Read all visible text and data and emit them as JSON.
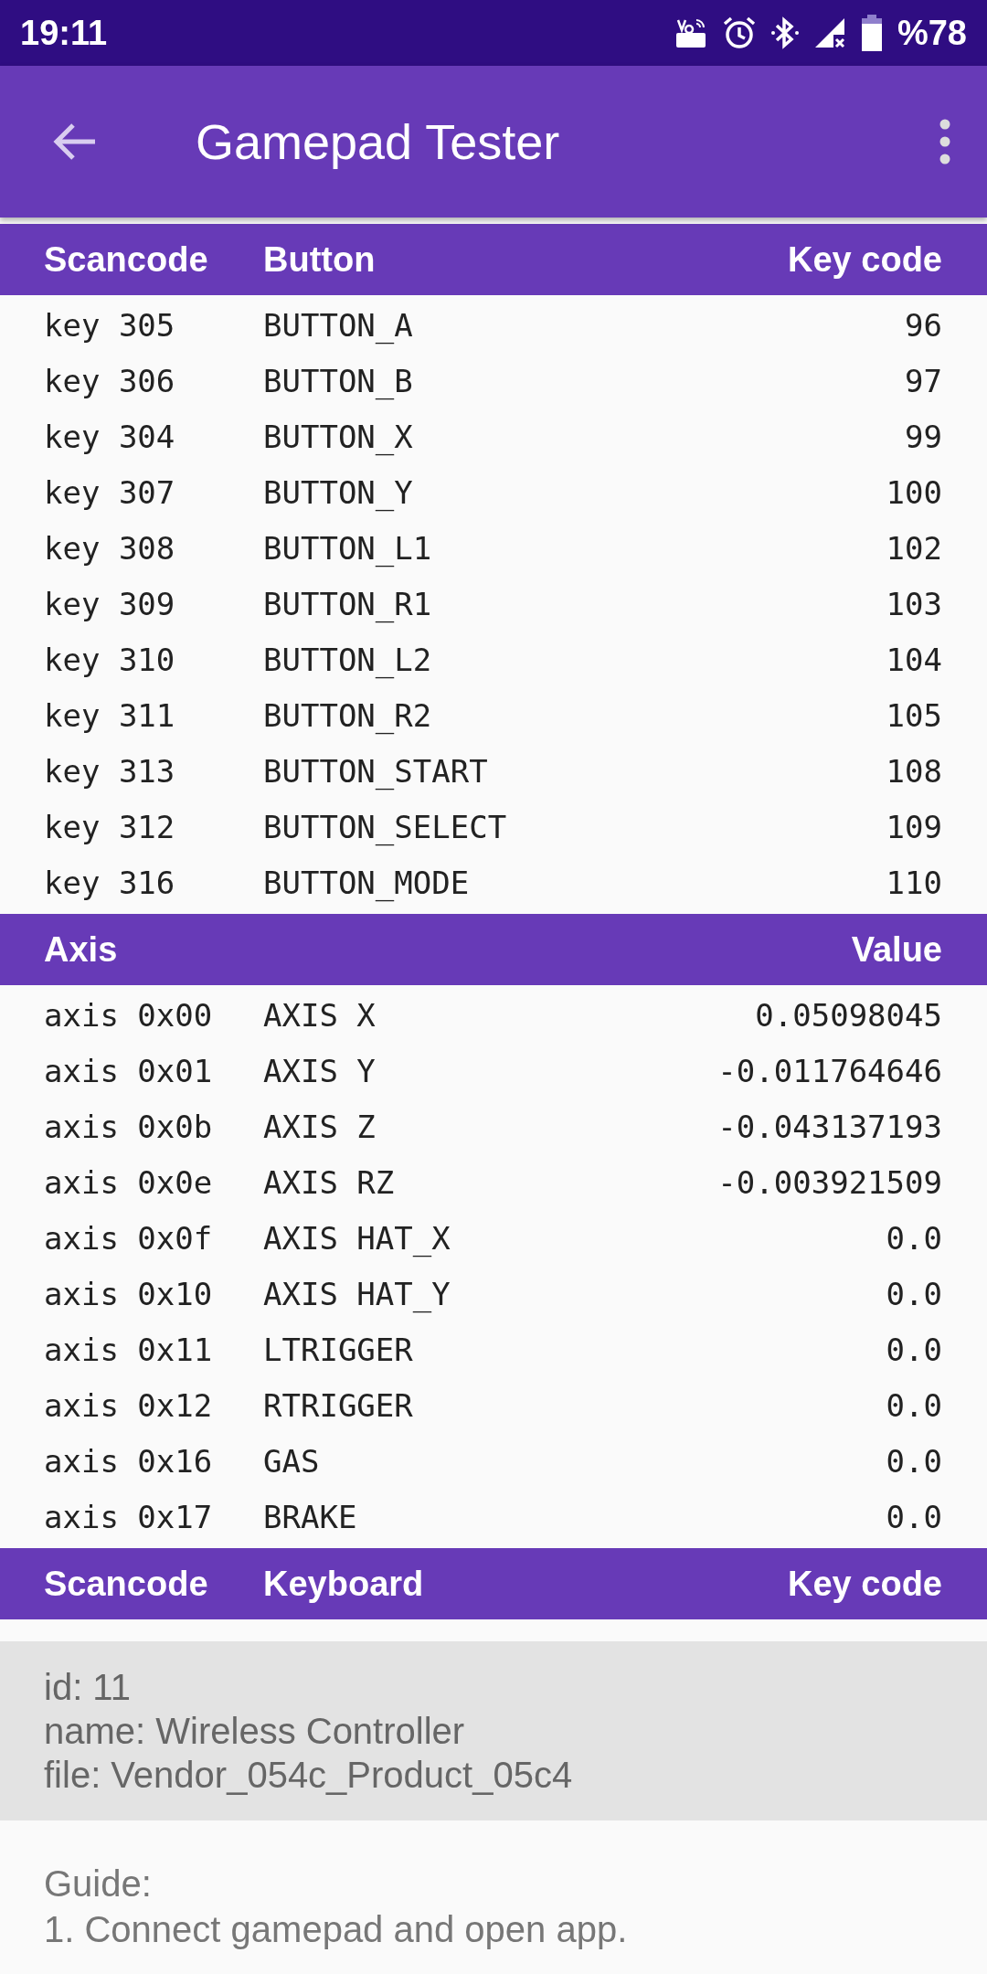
{
  "status_bar": {
    "time": "19:11",
    "battery": "%78"
  },
  "app_bar": {
    "title": "Gamepad Tester"
  },
  "buttons_table": {
    "columns": [
      "Scancode",
      "Button",
      "Key code"
    ],
    "rows": [
      [
        "key 305",
        "BUTTON_A",
        "96"
      ],
      [
        "key 306",
        "BUTTON_B",
        "97"
      ],
      [
        "key 304",
        "BUTTON_X",
        "99"
      ],
      [
        "key 307",
        "BUTTON_Y",
        "100"
      ],
      [
        "key 308",
        "BUTTON_L1",
        "102"
      ],
      [
        "key 309",
        "BUTTON_R1",
        "103"
      ],
      [
        "key 310",
        "BUTTON_L2",
        "104"
      ],
      [
        "key 311",
        "BUTTON_R2",
        "105"
      ],
      [
        "key 313",
        "BUTTON_START",
        "108"
      ],
      [
        "key 312",
        "BUTTON_SELECT",
        "109"
      ],
      [
        "key 316",
        "BUTTON_MODE",
        "110"
      ]
    ]
  },
  "axis_table": {
    "columns": [
      "Axis",
      "",
      "Value"
    ],
    "rows": [
      [
        "axis 0x00",
        "AXIS X",
        "0.05098045"
      ],
      [
        "axis 0x01",
        "AXIS Y",
        "-0.011764646"
      ],
      [
        "axis 0x0b",
        "AXIS Z",
        "-0.043137193"
      ],
      [
        "axis 0x0e",
        "AXIS RZ",
        "-0.003921509"
      ],
      [
        "axis 0x0f",
        "AXIS HAT_X",
        "0.0"
      ],
      [
        "axis 0x10",
        "AXIS HAT_Y",
        "0.0"
      ],
      [
        "axis 0x11",
        "LTRIGGER",
        "0.0"
      ],
      [
        "axis 0x12",
        "RTRIGGER",
        "0.0"
      ],
      [
        "axis 0x16",
        "GAS",
        "0.0"
      ],
      [
        "axis 0x17",
        "BRAKE",
        "0.0"
      ]
    ]
  },
  "keyboard_table": {
    "columns": [
      "Scancode",
      "Keyboard",
      "Key code"
    ]
  },
  "device_info": [
    "id: 11",
    "name: Wireless Controller",
    "file: Vendor_054c_Product_05c4"
  ],
  "guide": [
    "Guide:",
    "1. Connect gamepad and open app."
  ]
}
